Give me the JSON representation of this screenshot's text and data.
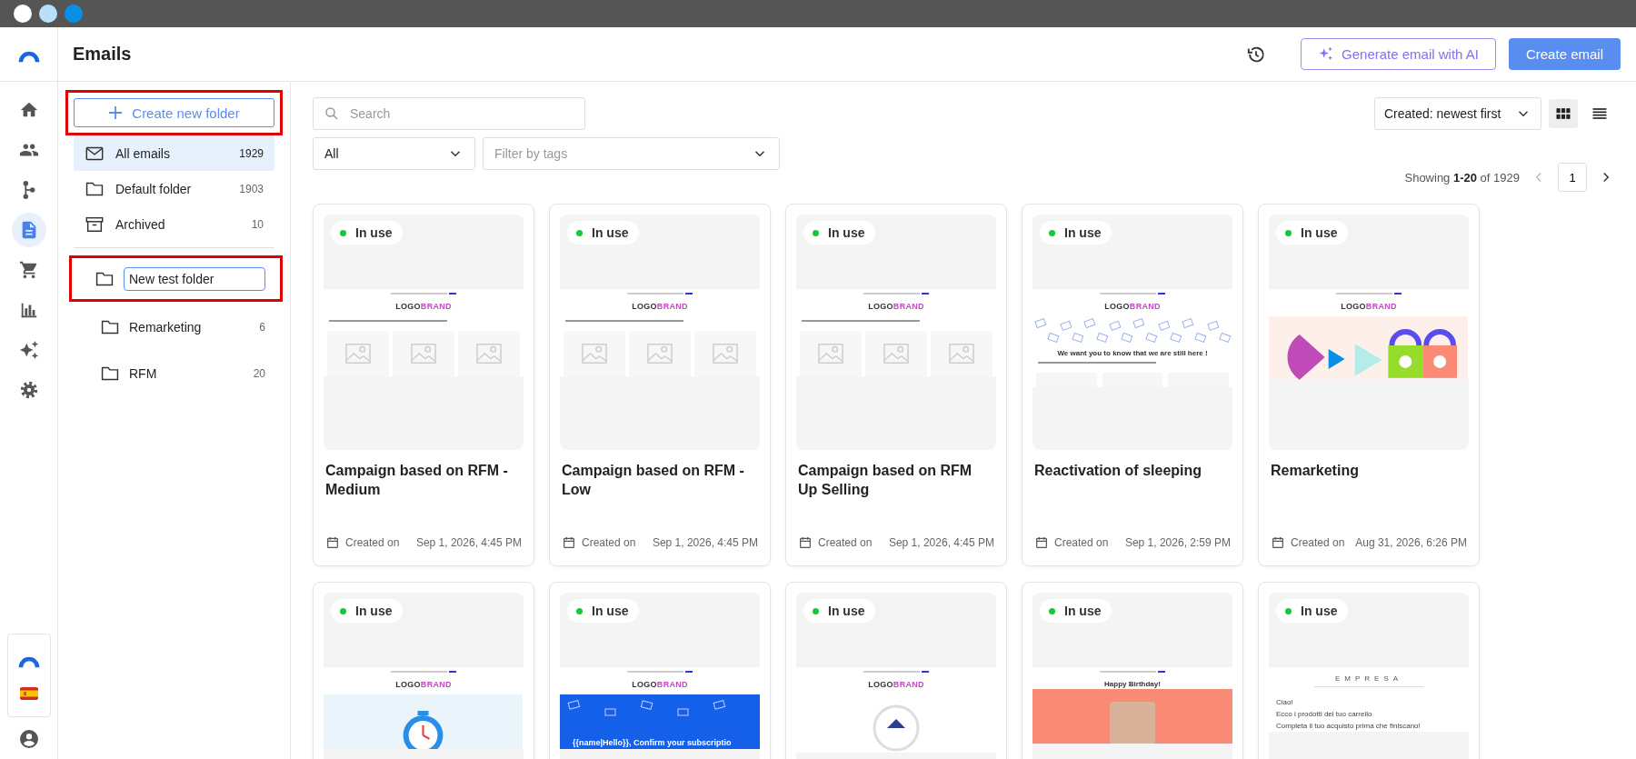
{
  "header": {
    "title": "Emails",
    "ai_button": "Generate email with AI",
    "create_button": "Create email"
  },
  "rail": {
    "items": [
      {
        "kind": "home",
        "selected": false
      },
      {
        "kind": "people",
        "selected": false
      },
      {
        "kind": "branch",
        "selected": false
      },
      {
        "kind": "document",
        "selected": true
      },
      {
        "kind": "cart",
        "selected": false
      },
      {
        "kind": "chart",
        "selected": false
      },
      {
        "kind": "sparkle",
        "selected": false
      },
      {
        "kind": "gear",
        "selected": false
      }
    ]
  },
  "folders": {
    "create_button": {
      "label": "Create new folder",
      "highlighted": true
    },
    "items": [
      {
        "kind": "mail",
        "label": "All emails",
        "count": "1929",
        "selected": true
      },
      {
        "kind": "folder",
        "label": "Default folder",
        "count": "1903",
        "selected": false
      },
      {
        "kind": "archive",
        "label": "Archived",
        "count": "10",
        "selected": false
      }
    ],
    "custom": [
      {
        "kind": "editing",
        "value": "New test folder",
        "highlighted": true
      },
      {
        "kind": "folder",
        "label": "Remarketing",
        "count": "6",
        "highlighted": false
      },
      {
        "kind": "folder",
        "label": "RFM",
        "count": "20",
        "highlighted": false
      }
    ]
  },
  "toolbar": {
    "search": {
      "placeholder": "Search"
    },
    "type_filter": {
      "value": "All"
    },
    "tags_filter": {
      "placeholder": "Filter by tags"
    },
    "sort": {
      "value": "Created: newest first"
    },
    "views": [
      {
        "kind": "grid",
        "selected": true
      },
      {
        "kind": "list",
        "selected": false
      }
    ]
  },
  "pagination": {
    "summary": "Showing **1-20** of 1929",
    "prev_disabled": true,
    "page": "1"
  },
  "cards": [
    {
      "status": "In use",
      "title": "Campaign based on RFM - Medium",
      "created_label": "Created on",
      "date": "Sep 1, 2026, 4:45 PM",
      "blocks": [
        {
          "kind": "preheader"
        },
        {
          "kind": "logo",
          "parts": [
            "LOGO",
            "BRAND"
          ]
        },
        {
          "kind": "lines"
        },
        {
          "kind": "products"
        }
      ]
    },
    {
      "status": "In use",
      "title": "Campaign based on RFM - Low",
      "created_label": "Created on",
      "date": "Sep 1, 2026, 4:45 PM",
      "blocks": [
        {
          "kind": "preheader"
        },
        {
          "kind": "logo",
          "parts": [
            "LOGO",
            "BRAND"
          ]
        },
        {
          "kind": "lines"
        },
        {
          "kind": "products"
        }
      ]
    },
    {
      "status": "In use",
      "title": "Campaign based on RFM Up Selling",
      "created_label": "Created on",
      "date": "Sep 1, 2026, 4:45 PM",
      "blocks": [
        {
          "kind": "preheader"
        },
        {
          "kind": "logo",
          "parts": [
            "LOGO",
            "BRAND"
          ]
        },
        {
          "kind": "lines"
        },
        {
          "kind": "products"
        }
      ]
    },
    {
      "status": "In use",
      "title": "Reactivation of sleeping",
      "created_label": "Created on",
      "date": "Sep 1, 2026, 2:59 PM",
      "blocks": [
        {
          "kind": "preheader"
        },
        {
          "kind": "logo",
          "parts": [
            "LOGO",
            "BRAND"
          ]
        },
        {
          "kind": "envelopes"
        },
        {
          "kind": "heading",
          "text": "We want you to know that we are still here !"
        },
        {
          "kind": "lines"
        },
        {
          "kind": "tiles"
        }
      ]
    },
    {
      "status": "In use",
      "title": "Remarketing",
      "created_label": "Created on",
      "date": "Aug 31, 2026, 6:26 PM",
      "blocks": [
        {
          "kind": "preheader"
        },
        {
          "kind": "logo",
          "parts": [
            "LOGO",
            "BRAND"
          ]
        },
        {
          "kind": "shapes"
        }
      ]
    },
    {
      "status": "In use",
      "blocks": [
        {
          "kind": "preheader"
        },
        {
          "kind": "logo",
          "parts": [
            "LOGO",
            "BRAND"
          ]
        },
        {
          "kind": "clock"
        }
      ]
    },
    {
      "status": "In use",
      "blocks": [
        {
          "kind": "preheader"
        },
        {
          "kind": "logo",
          "parts": [
            "LOGO",
            "BRAND"
          ]
        },
        {
          "kind": "banner",
          "text": "{{name|Hello}}, Confirm your subscriptio"
        }
      ]
    },
    {
      "status": "In use",
      "blocks": [
        {
          "kind": "preheader"
        },
        {
          "kind": "logo",
          "parts": [
            "LOGO",
            "BRAND"
          ]
        },
        {
          "kind": "circle"
        }
      ]
    },
    {
      "status": "In use",
      "blocks": [
        {
          "kind": "preheader"
        },
        {
          "kind": "heading",
          "text": "Happy Birthday!"
        },
        {
          "kind": "photo"
        }
      ]
    },
    {
      "status": "In use",
      "blocks": [
        {
          "kind": "wordmark",
          "text": "EMPRESA"
        },
        {
          "kind": "text",
          "text": "Ciao!"
        },
        {
          "kind": "text",
          "text": "Ecco i prodotti del tuo carrello"
        },
        {
          "kind": "text",
          "text": "Completa il tuo acquisto prima che finiscano!"
        }
      ]
    }
  ]
}
